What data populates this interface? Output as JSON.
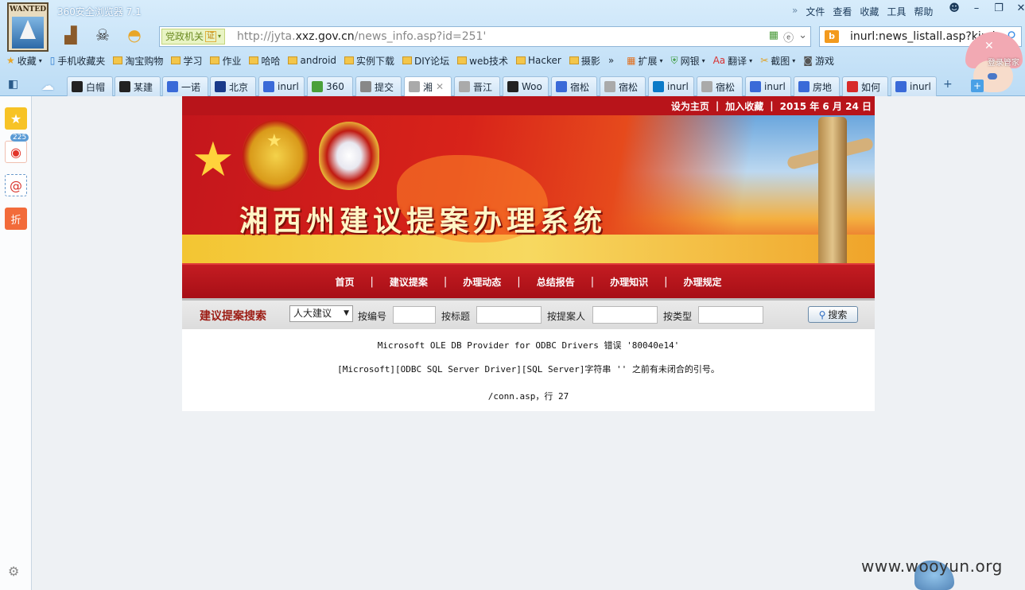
{
  "browser": {
    "app_title": "360安全浏览器 7.1",
    "logo_text": "WANTED",
    "menus": [
      "文件",
      "查看",
      "收藏",
      "工具",
      "帮助"
    ],
    "address": {
      "tag": "党政机关",
      "tag_badge": "证",
      "url_prefix": "http://jyta.",
      "url_domain": "xxz.gov.cn",
      "url_suffix": "/news_info.asp?id=251'"
    },
    "search": {
      "engine": "b",
      "query": "inurl:news_listall.asp?kind"
    },
    "bookmarks": [
      "收藏",
      "手机收藏夹",
      "淘宝购物",
      "学习",
      "作业",
      "哈哈",
      "android",
      "实例下载",
      "DIY论坛",
      "web技术",
      "Hacker",
      "摄影"
    ],
    "extras": [
      "扩展",
      "网银",
      "翻译",
      "截图",
      "游戏"
    ],
    "tabs": [
      "白帽",
      "某建",
      "一诺",
      "北京",
      "inurl",
      "360",
      "提交",
      "湘",
      "晋江",
      "Woo",
      "宿松",
      "宿松",
      "inurl",
      "宿松",
      "inurl",
      "房地",
      "如何",
      "inurl"
    ],
    "mascot_label": "登录管家",
    "sidebar_badge": "225",
    "sidebar_zhe": "折"
  },
  "page": {
    "top_links": [
      "设为主页",
      "|",
      "加入收藏",
      "|",
      "2015 年 6 月 24 日"
    ],
    "banner_title": "湘西州建议提案办理系统",
    "nav": [
      "首页",
      "建议提案",
      "办理动态",
      "总结报告",
      "办理知识",
      "办理规定"
    ],
    "search": {
      "title": "建议提案搜索",
      "select_value": "人大建议",
      "label_number": "按编号",
      "label_title": "按标题",
      "label_proposer": "按提案人",
      "label_type": "按类型",
      "button": "搜索"
    },
    "error": {
      "line1": "Microsoft OLE DB Provider for ODBC Drivers 错误 '80040e14'",
      "line2": "[Microsoft][ODBC SQL Server Driver][SQL Server]字符串 '' 之前有未闭合的引号。",
      "line3": "/conn.asp，行 27"
    }
  },
  "watermark": "www.wooyun.org"
}
